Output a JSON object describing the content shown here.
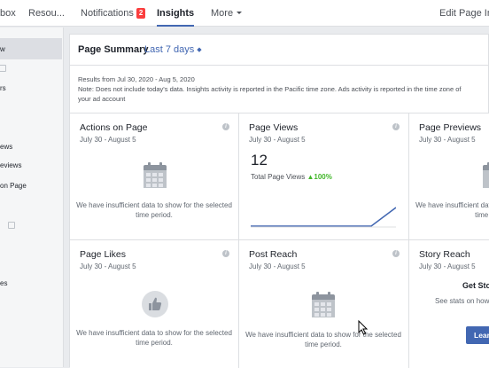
{
  "topnav": {
    "inbox": "box",
    "resources": "Resou...",
    "notifications": "Notifications",
    "notifications_count": "2",
    "insights": "Insights",
    "more": "More",
    "edit_page_info": "Edit Page Inf"
  },
  "sidebar": {
    "items": [
      "w",
      "rs",
      "ews",
      "eviews",
      "on Page",
      "es"
    ]
  },
  "summary": {
    "title": "Page Summary",
    "range": "Last 7 days",
    "results": "Results from Jul 30, 2020 - Aug 5, 2020",
    "note": "Note: Does not include today's data. Insights activity is reported in the Pacific time zone. Ads activity is reported in the time zone of your ad account"
  },
  "cards": {
    "actions": {
      "title": "Actions on Page",
      "date": "July 30 - August 5",
      "message": "We have insufficient data to show for the selected time period."
    },
    "views": {
      "title": "Page Views",
      "date": "July 30 - August 5",
      "value": "12",
      "subtitle": "Total Page Views",
      "change": "▲100%"
    },
    "previews": {
      "title": "Page Previews",
      "date": "July 30 - August 5",
      "message": "We have insufficient data to show for the selected time period."
    },
    "likes": {
      "title": "Page Likes",
      "date": "July 30 - August 5",
      "message": "We have insufficient data to show for the selected time period."
    },
    "reach": {
      "title": "Post Reach",
      "date": "July 30 - August 5",
      "message": "We have insufficient data to show for the selected time period."
    },
    "story": {
      "title": "Story Reach",
      "date": "July 30 - August 5",
      "get_started": "Get Stor",
      "message": "See stats on how stories hav",
      "learn": "Learn"
    }
  },
  "colors": {
    "accent": "#4267b2",
    "badge": "#fa3e3e",
    "positive": "#42b72a"
  }
}
